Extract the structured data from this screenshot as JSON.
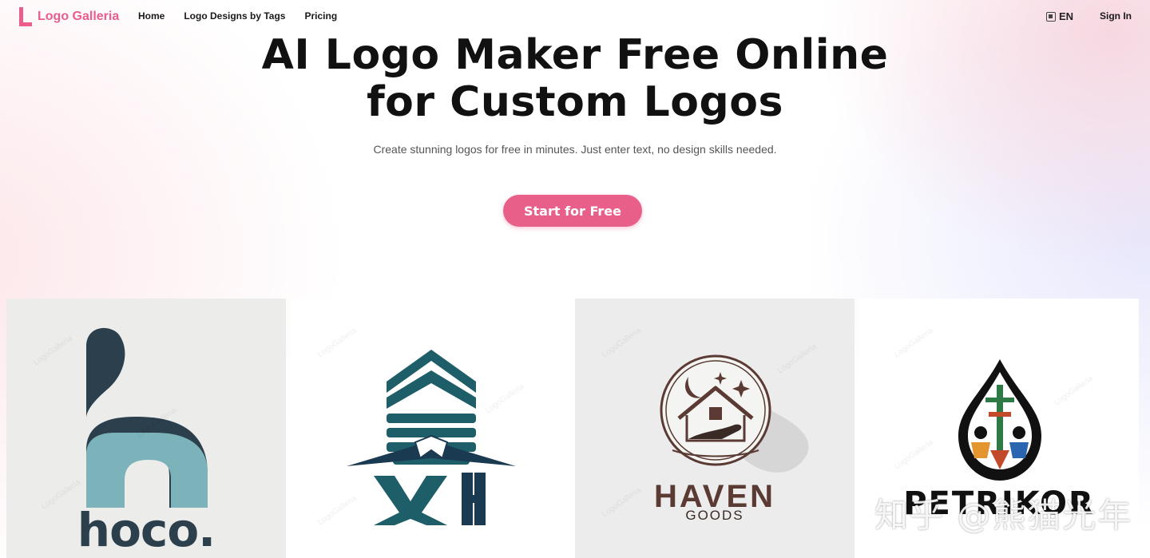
{
  "brand": {
    "name": "Logo Galleria",
    "accent": "#ea5d8c"
  },
  "nav": {
    "links": [
      "Home",
      "Logo Designs by Tags",
      "Pricing"
    ],
    "language": "EN",
    "language_icon": "translate-icon",
    "sign_in": "Sign In"
  },
  "hero": {
    "title_line1": "AI Logo Maker Free Online",
    "title_line2": "for Custom Logos",
    "subtitle": "Create stunning logos for free in minutes. Just enter text, no design skills needed.",
    "cta": "Start for Free",
    "cta_color": "#e8608a"
  },
  "gallery": {
    "watermark": "LogoGalleria",
    "cards": [
      {
        "caption": "hoco."
      },
      {
        "caption": "XH"
      },
      {
        "caption": "HAVEN",
        "subcaption": "GOODS"
      },
      {
        "caption": "PETRIKOR"
      }
    ]
  },
  "overlay_text": "知乎 @熊猫光年"
}
